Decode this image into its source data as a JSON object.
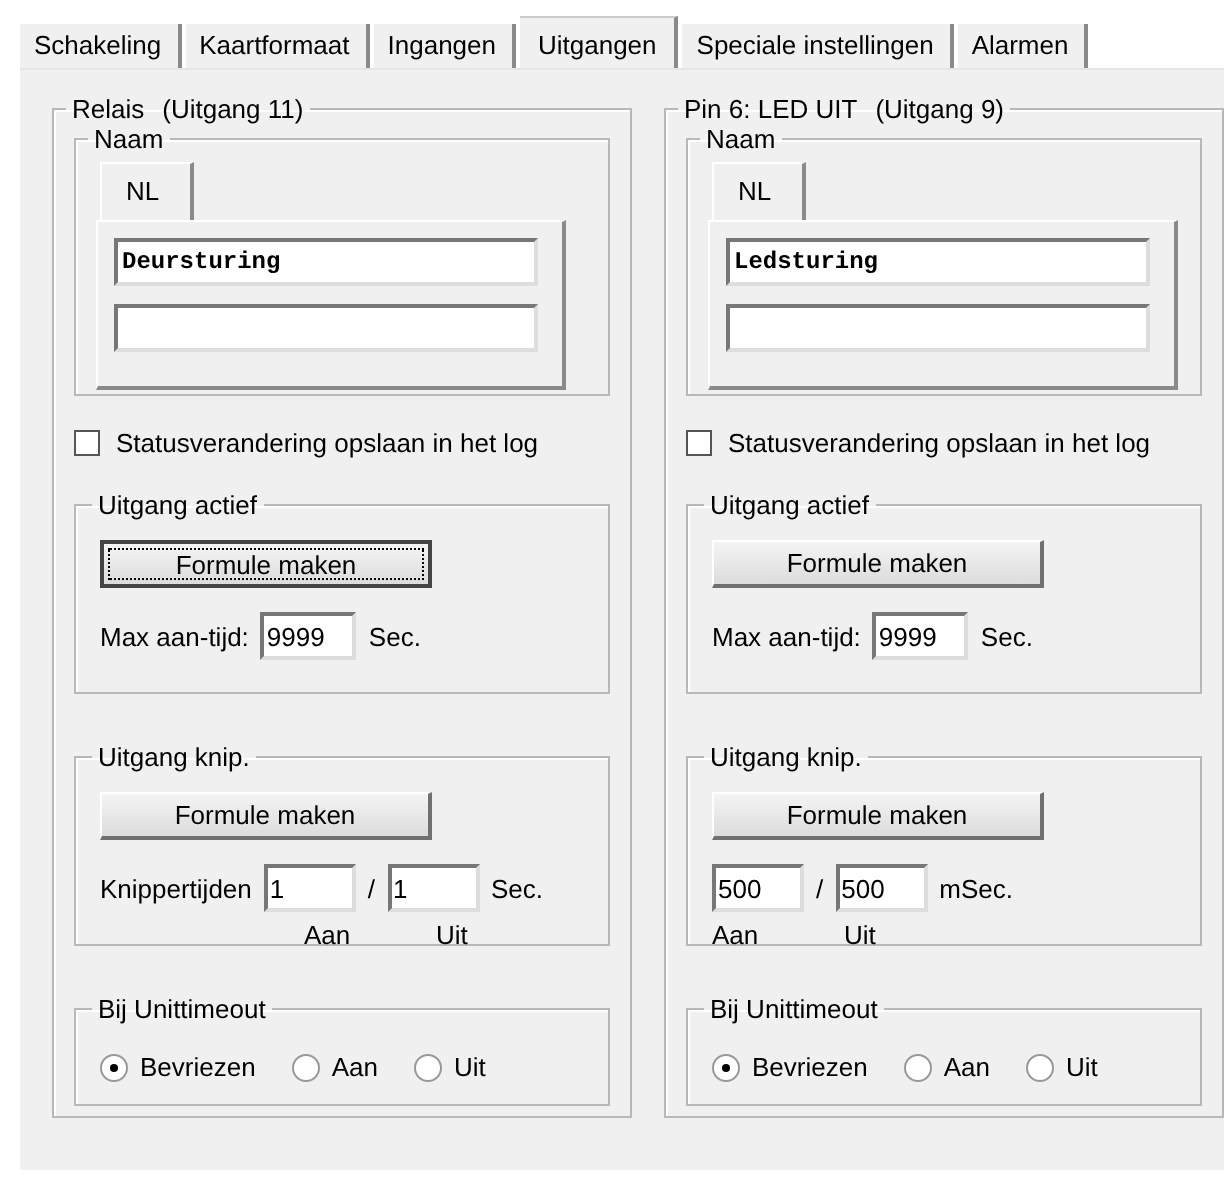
{
  "tabs": [
    {
      "label": "Schakeling",
      "selected": false
    },
    {
      "label": "Kaartformaat",
      "selected": false
    },
    {
      "label": "Ingangen",
      "selected": false
    },
    {
      "label": "Uitgangen",
      "selected": true
    },
    {
      "label": "Speciale instellingen",
      "selected": false
    },
    {
      "label": "Alarmen",
      "selected": false
    }
  ],
  "outputs": [
    {
      "title": "Relais",
      "output_number": "(Uitgang 11)",
      "naam": {
        "legend": "Naam",
        "tab": "NL",
        "value": "Deursturing"
      },
      "log_checkbox": {
        "label": "Statusverandering opslaan in het log",
        "checked": false
      },
      "active": {
        "legend": "Uitgang actief",
        "button": {
          "label": "Formule maken",
          "focused": true
        },
        "max_label": "Max aan-tijd:",
        "max_value": "9999",
        "unit": "Sec."
      },
      "blink": {
        "legend": "Uitgang knip.",
        "button": {
          "label": "Formule maken",
          "focused": false
        },
        "label": "Knippertijden",
        "on_value": "1",
        "separator": "/",
        "off_value": "1",
        "unit": "Sec.",
        "on_label": "Aan",
        "off_label": "Uit"
      },
      "timeout": {
        "legend": "Bij Unittimeout",
        "options": [
          {
            "label": "Bevriezen",
            "selected": true
          },
          {
            "label": "Aan",
            "selected": false
          },
          {
            "label": "Uit",
            "selected": false
          }
        ]
      }
    },
    {
      "title": "Pin 6: LED UIT",
      "output_number": "(Uitgang 9)",
      "naam": {
        "legend": "Naam",
        "tab": "NL",
        "value": "Ledsturing"
      },
      "log_checkbox": {
        "label": "Statusverandering opslaan in het log",
        "checked": false
      },
      "active": {
        "legend": "Uitgang actief",
        "button": {
          "label": "Formule maken",
          "focused": false
        },
        "max_label": "Max aan-tijd:",
        "max_value": "9999",
        "unit": "Sec."
      },
      "blink": {
        "legend": "Uitgang knip.",
        "button": {
          "label": "Formule maken",
          "focused": false
        },
        "on_value": "500",
        "separator": "/",
        "off_value": "500",
        "unit": "mSec.",
        "on_label": "Aan",
        "off_label": "Uit"
      },
      "timeout": {
        "legend": "Bij Unittimeout",
        "options": [
          {
            "label": "Bevriezen",
            "selected": true
          },
          {
            "label": "Aan",
            "selected": false
          },
          {
            "label": "Uit",
            "selected": false
          }
        ]
      }
    }
  ]
}
